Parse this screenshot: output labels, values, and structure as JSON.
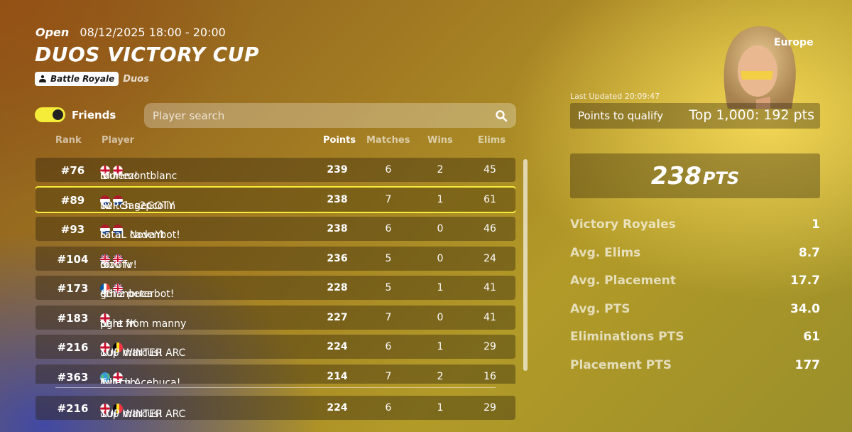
{
  "event": {
    "status": "Open",
    "datetime": "08/12/2025 18:00 - 20:00",
    "title": "DUOS VICTORY CUP",
    "mode_badge": "Battle Royale",
    "mode_sub": "Duos"
  },
  "friends": {
    "label": "Friends",
    "enabled": true
  },
  "search": {
    "placeholder": "Player search"
  },
  "table": {
    "headers": {
      "rank": "Rank",
      "player": "Player",
      "points": "Points",
      "matches": "Matches",
      "wins": "Wins",
      "elims": "Elims"
    },
    "rows": [
      {
        "rank": "#76",
        "p1": "louiemontblanc",
        "f1": "england",
        "p2": "morlez!",
        "f2": "england",
        "points": "239",
        "matches": "6",
        "wins": "2",
        "elims": "45"
      },
      {
        "rank": "#89",
        "p1": "Twitch s2pcolin",
        "f1": "netherlands",
        "p2": "S2P SageGOTY",
        "f2": "netherlands",
        "points": "238",
        "matches": "7",
        "wins": "1",
        "elims": "61",
        "highlight": true
      },
      {
        "rank": "#93",
        "p1": "FataL cadenbot!",
        "f1": "netherlands",
        "p2": "FataL NovaYt",
        "f2": "netherlands",
        "points": "238",
        "matches": "6",
        "wins": "0",
        "elims": "46"
      },
      {
        "rank": "#104",
        "p1": "rovofv",
        "f1": "uk",
        "p2": "dizo fv!",
        "f2": "uk",
        "points": "236",
        "matches": "5",
        "wins": "0",
        "elims": "24"
      },
      {
        "rank": "#173",
        "p1": "g3nz peterbot!",
        "f1": "france",
        "p2": "ethanbuca",
        "f2": "uk",
        "points": "228",
        "matches": "5",
        "wins": "1",
        "elims": "41"
      },
      {
        "rank": "#183",
        "p1": "fight Ж",
        "f1": "",
        "p2": "pare from manny",
        "f2": "england",
        "points": "227",
        "matches": "7",
        "wins": "0",
        "elims": "41"
      },
      {
        "rank": "#216",
        "p1": "1up marcus!",
        "f1": "england",
        "p2": "1UP WINTER ARC",
        "f2": "belgium",
        "points": "224",
        "matches": "6",
        "wins": "1",
        "elims": "29"
      },
      {
        "rank": "#363",
        "p1": "Julle vb",
        "f1": "globe",
        "p2": "Twitch Acebuca!",
        "f2": "england",
        "points": "214",
        "matches": "7",
        "wins": "2",
        "elims": "16"
      }
    ],
    "pinned": {
      "rank": "#216",
      "p1": "1up marcus!",
      "f1": "england",
      "p2": "1UP WINTER ARC",
      "f2": "belgium",
      "points": "224",
      "matches": "6",
      "wins": "1",
      "elims": "29"
    }
  },
  "panel": {
    "region": "Europe",
    "last_updated": "Last Updated 20:09:47",
    "qualify_label": "Points to qualify",
    "qualify_value": "Top 1,000: 192 pts",
    "total_points": "238",
    "total_unit": "PTS",
    "stats": [
      {
        "label": "Victory Royales",
        "value": "1"
      },
      {
        "label": "Avg. Elims",
        "value": "8.7"
      },
      {
        "label": "Avg. Placement",
        "value": "17.7"
      },
      {
        "label": "Avg. PTS",
        "value": "34.0"
      },
      {
        "label": "Eliminations PTS",
        "value": "61"
      },
      {
        "label": "Placement PTS",
        "value": "177"
      }
    ]
  },
  "colors": {
    "accent": "#f5ec3a",
    "row_bg": "#3a2c0c"
  }
}
